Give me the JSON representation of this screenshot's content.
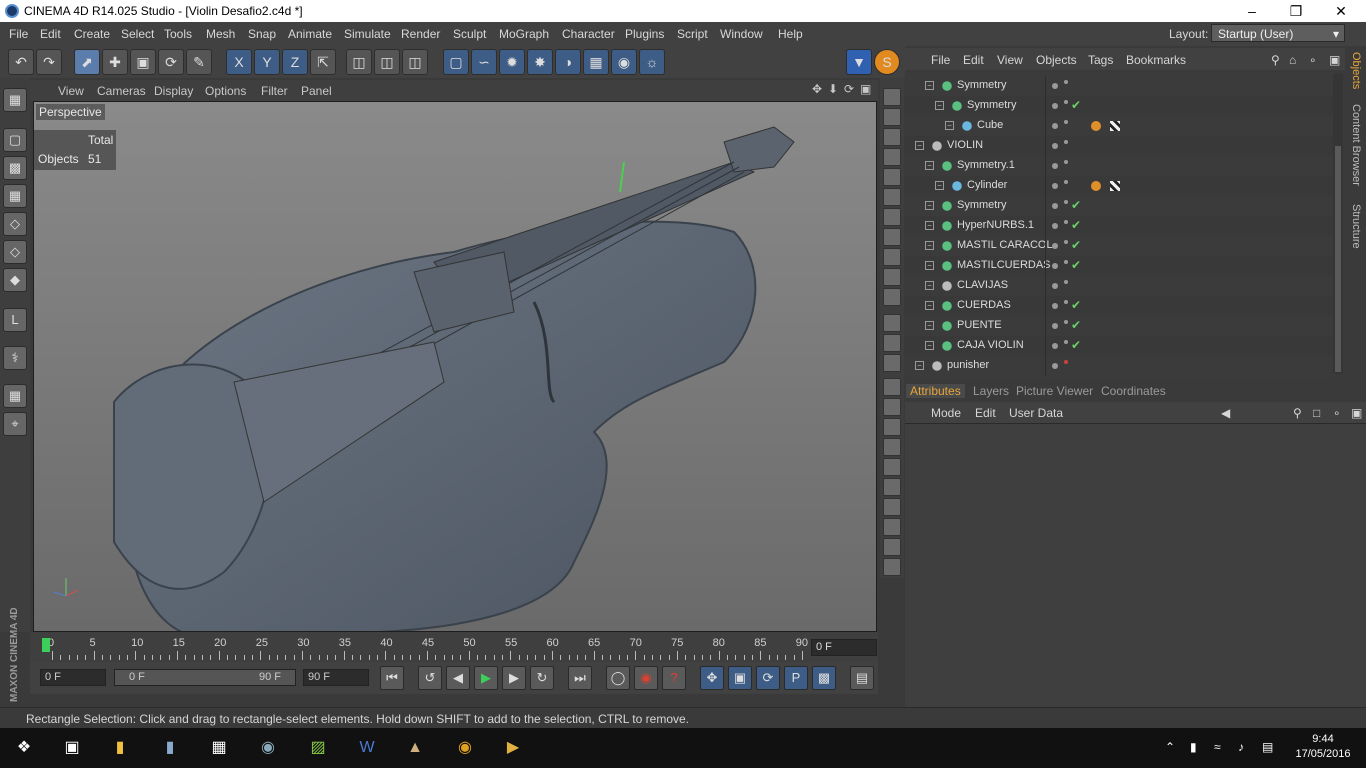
{
  "window": {
    "title": "CINEMA 4D R14.025 Studio - [Violin Desafio2.c4d *]",
    "minimize_icon": "minimize-icon",
    "restore_icon": "restore-icon",
    "close_icon": "close-icon"
  },
  "menu": [
    "File",
    "Edit",
    "Create",
    "Select",
    "Tools",
    "Mesh",
    "Snap",
    "Animate",
    "Simulate",
    "Render",
    "Sculpt",
    "MoGraph",
    "Character",
    "Plugins",
    "Script",
    "Window",
    "Help"
  ],
  "layout": {
    "label": "Layout:",
    "value": "Startup (User)"
  },
  "viewport": {
    "menu": [
      "View",
      "Cameras",
      "Display",
      "Options",
      "Filter",
      "Panel"
    ],
    "label": "Perspective",
    "hud_header": "Total",
    "hud_row_label": "Objects",
    "hud_row_value": "51"
  },
  "timeline": {
    "ticks": [
      "0",
      "5",
      "10",
      "15",
      "20",
      "25",
      "30",
      "35",
      "40",
      "45",
      "50",
      "55",
      "60",
      "65",
      "70",
      "75",
      "80",
      "85",
      "90"
    ],
    "current_frame": "0 F",
    "start_field": "0 F",
    "range_start": "0 F",
    "range_end": "90 F",
    "end_field": "90 F"
  },
  "brand": "MAXON CINEMA 4D",
  "status": "Rectangle Selection: Click and drag to rectangle-select elements. Hold down SHIFT to add to the selection, CTRL to remove.",
  "object_manager": {
    "menu": [
      "File",
      "Edit",
      "View",
      "Objects",
      "Tags",
      "Bookmarks"
    ],
    "objects": [
      {
        "name": "Symmetry",
        "icon": "symmetry-icon",
        "check": ""
      },
      {
        "name": "Symmetry",
        "icon": "sphere-icon",
        "check": "✔"
      },
      {
        "name": "Cube",
        "icon": "polygon-object-icon",
        "check": ""
      },
      {
        "name": "VIOLIN",
        "icon": "null-object-icon",
        "check": ""
      },
      {
        "name": "Symmetry.1",
        "icon": "symmetry-icon",
        "check": ""
      },
      {
        "name": "Cylinder",
        "icon": "polygon-object-icon",
        "check": ""
      },
      {
        "name": "Symmetry",
        "icon": "sphere-icon",
        "check": "✔"
      },
      {
        "name": "HyperNURBS.1",
        "icon": "hypernurbs-icon",
        "check": "✔"
      },
      {
        "name": "MASTIL CARACOL",
        "icon": "hypernurbs-icon",
        "check": "✔"
      },
      {
        "name": "MASTILCUERDAS",
        "icon": "hypernurbs-icon",
        "check": "✔"
      },
      {
        "name": "CLAVIJAS",
        "icon": "null-object-icon",
        "check": ""
      },
      {
        "name": "CUERDAS",
        "icon": "sphere-icon",
        "check": "✔"
      },
      {
        "name": "PUENTE",
        "icon": "hypernurbs-icon",
        "check": "✔"
      },
      {
        "name": "CAJA VIOLIN",
        "icon": "hypernurbs-icon",
        "check": "✔"
      },
      {
        "name": "punisher",
        "icon": "null-object-icon",
        "check": ""
      }
    ],
    "side_tabs": [
      "Objects",
      "Content Browser",
      "Structure"
    ]
  },
  "attributes": {
    "tabs": [
      "Attributes",
      "Layers",
      "Picture Viewer",
      "Coordinates"
    ],
    "menu": [
      "Mode",
      "Edit",
      "User Data"
    ]
  },
  "taskbar": {
    "time": "9:44",
    "date": "17/05/2016"
  },
  "colors": {
    "accent": "#e6a63c",
    "check": "#6ad06a",
    "viewport_bg": "#7a7a7a"
  }
}
